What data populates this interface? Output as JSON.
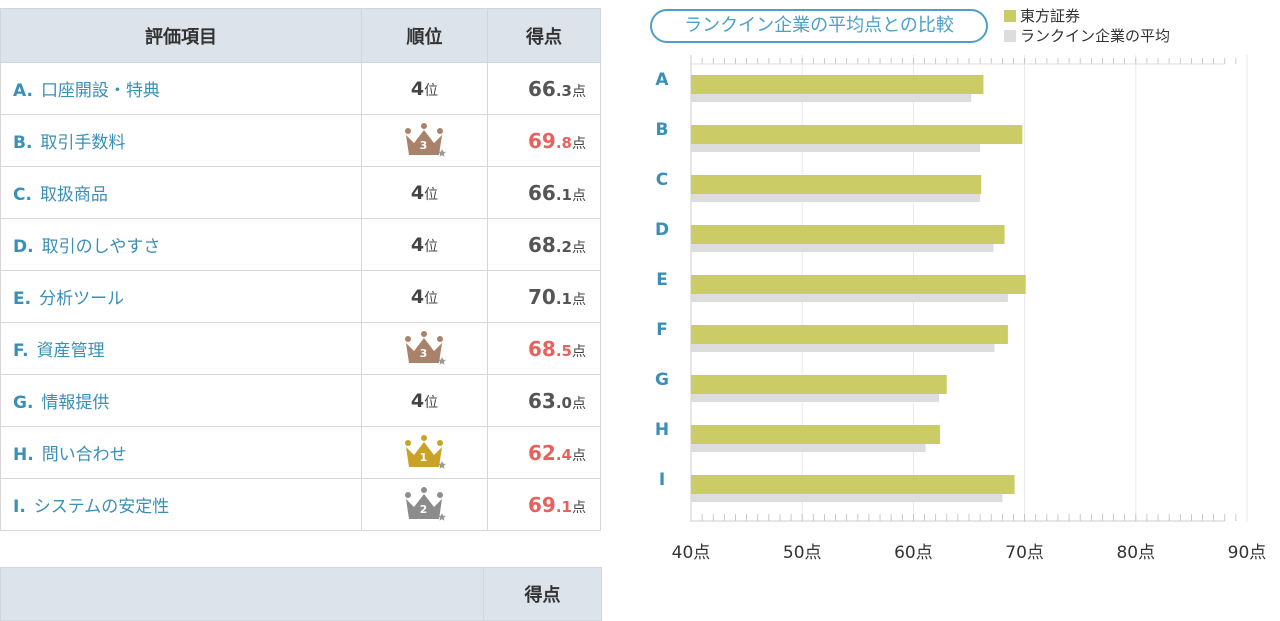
{
  "table": {
    "headers": {
      "item": "評価項目",
      "rank": "順位",
      "score": "得点"
    },
    "rank_unit": "位",
    "score_unit": "点",
    "rows": [
      {
        "code": "A.",
        "label": "口座開設・特典",
        "rank": "4",
        "crown": "none",
        "score_int": "66",
        "score_dec": ".3",
        "highlight": false
      },
      {
        "code": "B.",
        "label": "取引手数料",
        "rank": "3",
        "crown": "bronze",
        "score_int": "69",
        "score_dec": ".8",
        "highlight": true
      },
      {
        "code": "C.",
        "label": "取扱商品",
        "rank": "4",
        "crown": "none",
        "score_int": "66",
        "score_dec": ".1",
        "highlight": false
      },
      {
        "code": "D.",
        "label": "取引のしやすさ",
        "rank": "4",
        "crown": "none",
        "score_int": "68",
        "score_dec": ".2",
        "highlight": false
      },
      {
        "code": "E.",
        "label": "分析ツール",
        "rank": "4",
        "crown": "none",
        "score_int": "70",
        "score_dec": ".1",
        "highlight": false
      },
      {
        "code": "F.",
        "label": "資産管理",
        "rank": "3",
        "crown": "bronze",
        "score_int": "68",
        "score_dec": ".5",
        "highlight": true
      },
      {
        "code": "G.",
        "label": "情報提供",
        "rank": "4",
        "crown": "none",
        "score_int": "63",
        "score_dec": ".0",
        "highlight": false
      },
      {
        "code": "H.",
        "label": "問い合わせ",
        "rank": "1",
        "crown": "gold",
        "score_int": "62",
        "score_dec": ".4",
        "highlight": true
      },
      {
        "code": "I.",
        "label": "システムの安定性",
        "rank": "2",
        "crown": "silver",
        "score_int": "69",
        "score_dec": ".1",
        "highlight": true
      }
    ]
  },
  "table2": {
    "header_score": "得点"
  },
  "colors": {
    "company": "#cccc66",
    "average": "#dddddd",
    "highlight": "#e8625d",
    "accent": "#3a8fb7",
    "gold": "#c9a227",
    "silver": "#8c8c8c",
    "bronze": "#a9826b"
  },
  "chart_data": {
    "type": "bar",
    "orientation": "horizontal",
    "title": "ランクイン企業の平均点との比較",
    "categories": [
      "A",
      "B",
      "C",
      "D",
      "E",
      "F",
      "G",
      "H",
      "I"
    ],
    "series": [
      {
        "name": "東方証券",
        "values": [
          66.3,
          69.8,
          66.1,
          68.2,
          70.1,
          68.5,
          63.0,
          62.4,
          69.1
        ]
      },
      {
        "name": "ランクイン企業の平均",
        "values": [
          65.2,
          66.0,
          66.0,
          67.2,
          68.5,
          67.3,
          62.3,
          61.1,
          68.0
        ]
      }
    ],
    "xlim": [
      40,
      90
    ],
    "xticks": [
      "40点",
      "50点",
      "60点",
      "70点",
      "80点",
      "90点"
    ],
    "grid": true,
    "legend_position": "top-right"
  }
}
